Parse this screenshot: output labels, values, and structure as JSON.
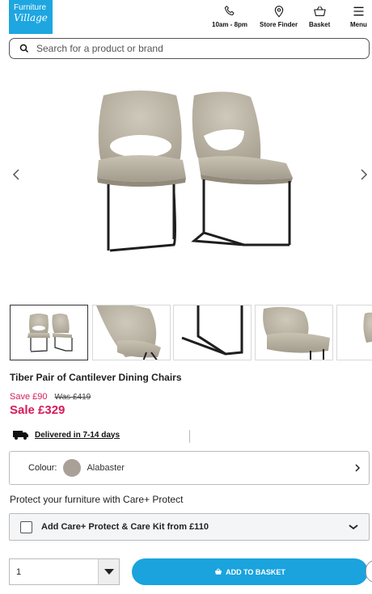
{
  "header": {
    "logo_line1": "Furniture",
    "logo_line2": "Village",
    "phone_label": "10am - 8pm",
    "store_label": "Store Finder",
    "basket_label": "Basket",
    "menu_label": "Menu"
  },
  "search": {
    "placeholder": "Search for a product or brand"
  },
  "gallery": {
    "thumbnail_count": 5,
    "active_index": 0
  },
  "product": {
    "title": "Tiber Pair of Cantilever Dining Chairs",
    "save_text": "Save £90",
    "was_text": "Was £419",
    "sale_text": "Sale £329"
  },
  "delivery": {
    "text": "Delivered in 7-14 days"
  },
  "colour": {
    "label": "Colour:",
    "value": "Alabaster",
    "swatch": "#a9a197"
  },
  "protect": {
    "heading": "Protect your furniture with Care+ Protect",
    "option_label": "Add Care+ Protect & Care Kit from £110"
  },
  "purchase": {
    "quantity": "1",
    "add_label": "ADD TO BASKET"
  },
  "colors": {
    "brand": "#1da6e0",
    "sale": "#d51b5c",
    "button": "#1aa3dd"
  }
}
